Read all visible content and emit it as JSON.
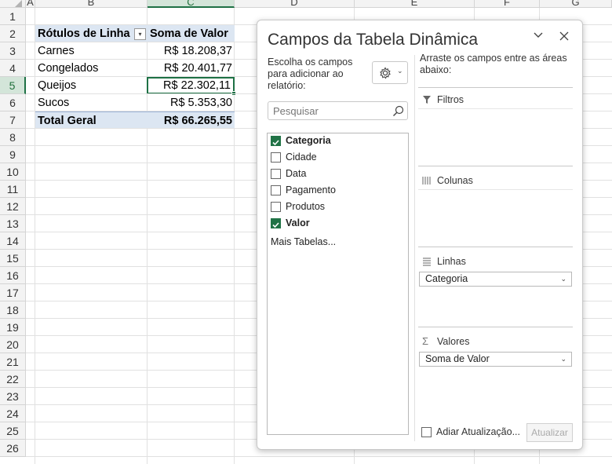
{
  "columns": [
    "A",
    "B",
    "C",
    "D",
    "E",
    "F",
    "G"
  ],
  "rows": [
    "1",
    "2",
    "3",
    "4",
    "5",
    "6",
    "7",
    "8",
    "9",
    "10",
    "11",
    "12",
    "13",
    "14",
    "15",
    "16",
    "17",
    "18",
    "19",
    "20",
    "21",
    "22",
    "23",
    "24",
    "25",
    "26"
  ],
  "pivot": {
    "header_label": "Rótulos de Linha",
    "header_value": "Soma de Valor",
    "items": [
      {
        "label": "Carnes",
        "value": "R$ 18.208,37"
      },
      {
        "label": "Congelados",
        "value": "R$ 20.401,77"
      },
      {
        "label": "Queijos",
        "value": "R$ 22.302,11"
      },
      {
        "label": "Sucos",
        "value": "R$ 5.353,30"
      }
    ],
    "total_label": "Total Geral",
    "total_value": "R$ 66.265,55"
  },
  "pane": {
    "title": "Campos da Tabela Dinâmica",
    "choose_label": "Escolha os campos para adicionar ao relatório:",
    "drag_label": "Arraste os campos entre as áreas abaixo:",
    "search_placeholder": "Pesquisar",
    "fields": [
      {
        "name": "Categoria",
        "checked": true
      },
      {
        "name": "Cidade",
        "checked": false
      },
      {
        "name": "Data",
        "checked": false
      },
      {
        "name": "Pagamento",
        "checked": false
      },
      {
        "name": "Produtos",
        "checked": false
      },
      {
        "name": "Valor",
        "checked": true
      }
    ],
    "more_tables": "Mais Tabelas...",
    "areas": {
      "filters": "Filtros",
      "columns": "Colunas",
      "rows": "Linhas",
      "values": "Valores"
    },
    "rows_chip": "Categoria",
    "values_chip": "Soma de Valor",
    "defer_label": "Adiar Atualização...",
    "update_label": "Atualizar"
  }
}
